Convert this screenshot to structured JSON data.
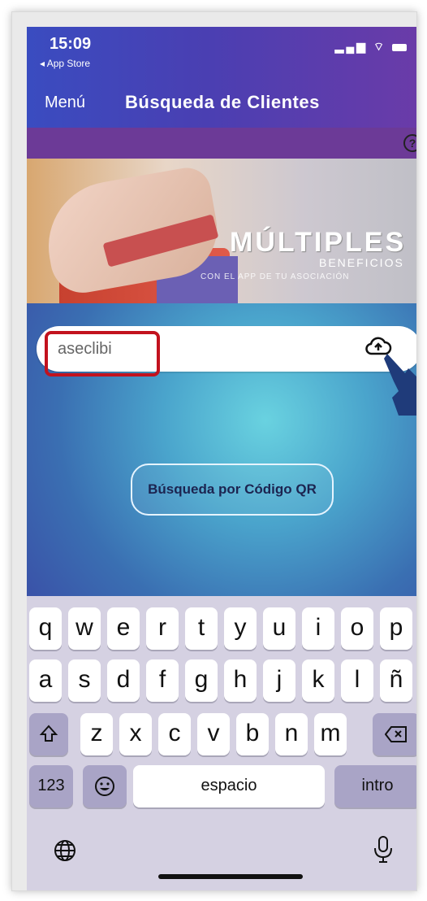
{
  "status_bar": {
    "time": "15:09",
    "back_app": "◂ App Store"
  },
  "nav": {
    "menu": "Menú",
    "title": "Búsqueda de Clientes"
  },
  "banner": {
    "title": "MÚLTIPLES",
    "subtitle": "BENEFICIOS",
    "tagline": "CON EL APP DE TU ASOCIACIÓN"
  },
  "search": {
    "value": "aseclibi"
  },
  "qr_button": {
    "label": "Búsqueda por Código QR"
  },
  "keyboard": {
    "row1": [
      "q",
      "w",
      "e",
      "r",
      "t",
      "y",
      "u",
      "i",
      "o",
      "p"
    ],
    "row2": [
      "a",
      "s",
      "d",
      "f",
      "g",
      "h",
      "j",
      "k",
      "l",
      "ñ"
    ],
    "row3": [
      "z",
      "x",
      "c",
      "v",
      "b",
      "n",
      "m"
    ],
    "numbers_key": "123",
    "space_key": "espacio",
    "enter_key": "intro"
  },
  "colors": {
    "header": "#4a3fb2",
    "purple_band": "#6c3a97",
    "highlight": "#c2121e",
    "keyboard_bg": "#d5d1e2"
  },
  "icons": [
    "help-icon",
    "cloud-search-icon",
    "pointer-hand-icon",
    "shift-icon",
    "backspace-icon",
    "emoji-icon",
    "globe-icon",
    "microphone-icon"
  ]
}
